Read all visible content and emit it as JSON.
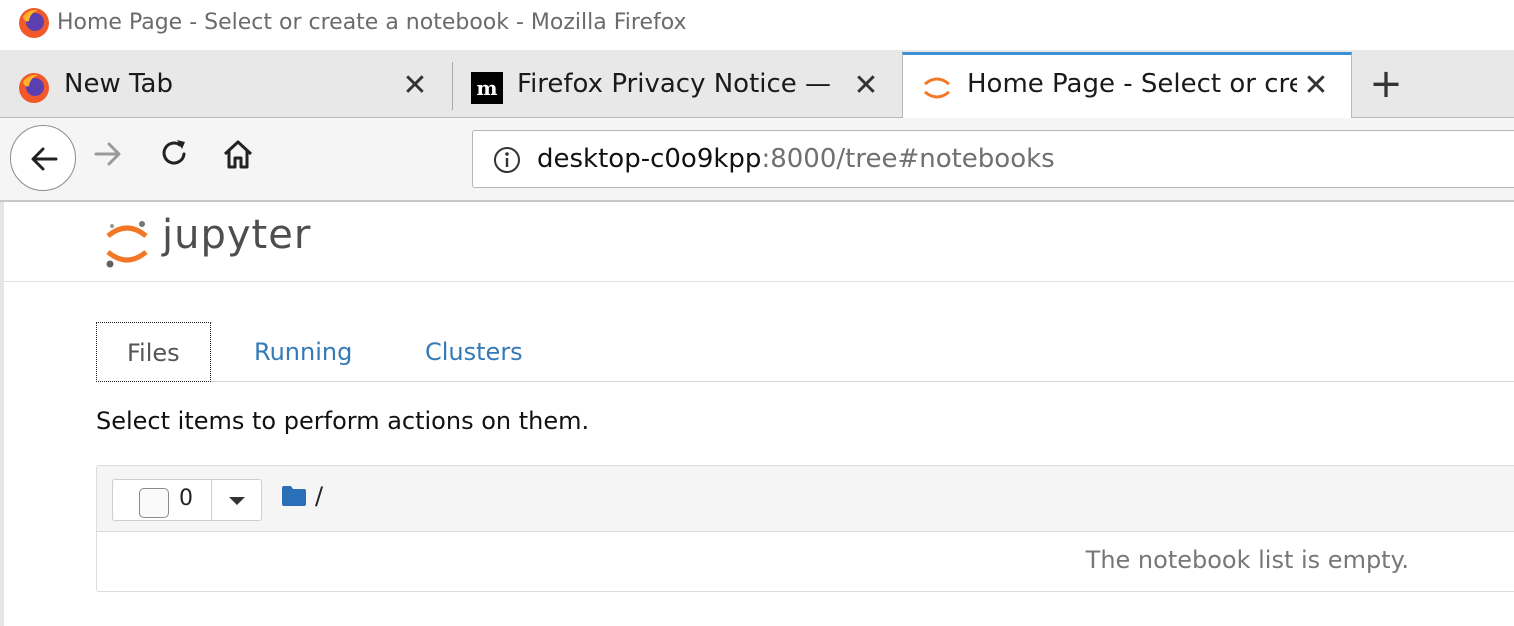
{
  "window": {
    "title": "Home Page - Select or create a notebook - Mozilla Firefox"
  },
  "tabs": [
    {
      "label": "New Tab",
      "icon": "firefox-icon",
      "active": false
    },
    {
      "label": "Firefox Privacy Notice — ",
      "icon": "mozilla-m-icon",
      "active": false
    },
    {
      "label": "Home Page - Select or cre",
      "icon": "jupyter-icon",
      "active": true
    }
  ],
  "tab_close_glyph": "✕",
  "new_tab_glyph": "+",
  "urlbar": {
    "host": "desktop-c0o9kpp",
    "rest": ":8000/tree#notebooks"
  },
  "jupyter": {
    "brand": "jupyter",
    "tabs": [
      "Files",
      "Running",
      "Clusters"
    ],
    "hint": "Select items to perform actions on them.",
    "selected_count": "0",
    "breadcrumb": "/",
    "empty_message": "The notebook list is empty."
  },
  "colors": {
    "link": "#337ab7",
    "jupyter_orange": "#f37726",
    "active_tab_top": "#3b8fd4"
  }
}
